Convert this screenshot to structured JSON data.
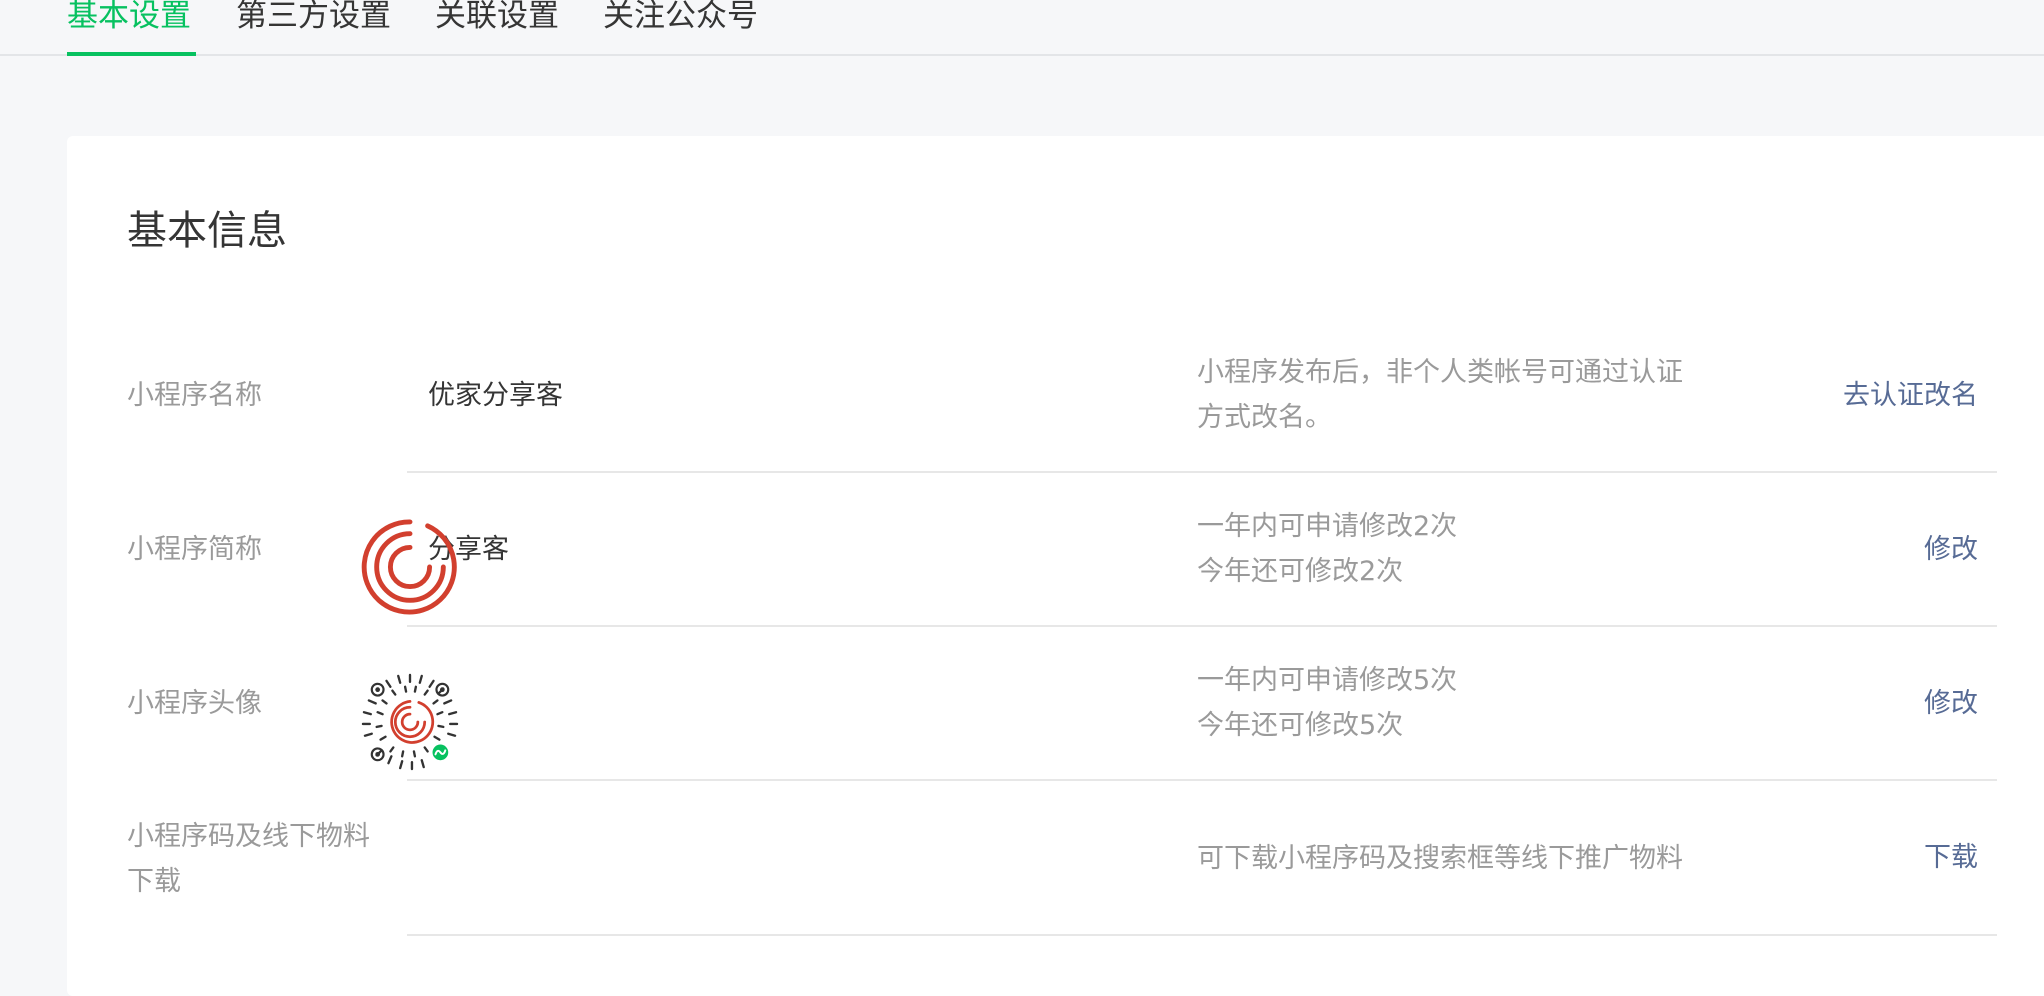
{
  "tabs": [
    {
      "label": "基本设置",
      "active": true
    },
    {
      "label": "第三方设置",
      "active": false
    },
    {
      "label": "关联设置",
      "active": false
    },
    {
      "label": "关注公众号",
      "active": false
    }
  ],
  "accent_color": "#07c160",
  "link_color": "#576b95",
  "card": {
    "title": "基本信息",
    "rows": [
      {
        "label": "小程序名称",
        "value": "优家分享客",
        "tip_line1": "小程序发布后，非个人类帐号可通过认证",
        "tip_line2": "方式改名。",
        "action": "去认证改名"
      },
      {
        "label": "小程序简称",
        "value": "分享客",
        "tip_line1": "一年内可申请修改2次",
        "tip_line2": "今年还可修改2次",
        "action": "修改"
      },
      {
        "label": "小程序头像",
        "value_icon": "mini-program-avatar-icon",
        "tip_line1": "一年内可申请修改5次",
        "tip_line2": "今年还可修改5次",
        "action": "修改"
      },
      {
        "label_line1": "小程序码及线下物料",
        "label_line2": "下载",
        "value_icon": "mini-program-code-icon",
        "tip_line1": "可下载小程序码及搜索框等线下推广物料",
        "action": "下载"
      }
    ]
  }
}
